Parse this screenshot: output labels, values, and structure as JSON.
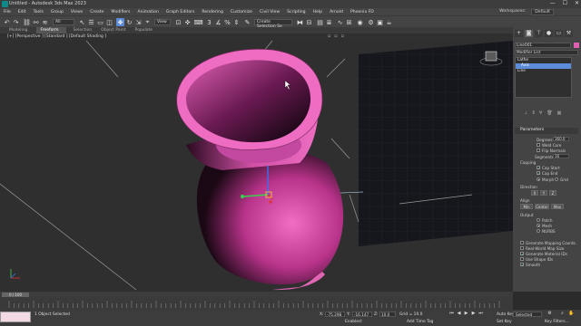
{
  "titlebar": {
    "title": "Untitled - Autodesk 3ds Max 2023",
    "minimize": "—",
    "maximize": "☐",
    "close": "✕"
  },
  "menubar": {
    "items": [
      "File",
      "Edit",
      "Tools",
      "Group",
      "Views",
      "Create",
      "Modifiers",
      "Animation",
      "Graph Editors",
      "Rendering",
      "Customize",
      "Civil View",
      "Scripting",
      "Help",
      "Arnold",
      "Phoenix FD"
    ],
    "workspaces_label": "Workspaces:",
    "workspace_value": "Default"
  },
  "toolbar": {
    "selection_filter": "All",
    "view_dropdown": "View",
    "named_sel": "Create Selection Se"
  },
  "ribbon": {
    "tabs": [
      "Modeling",
      "Freeform",
      "Selection",
      "Object Paint",
      "Populate"
    ],
    "active": "Freeform"
  },
  "viewport": {
    "label": "[+] [Perspective ] [Standard ] [Default Shading ]"
  },
  "command_panel": {
    "object_name": "Line001",
    "modifier_list": "Modifier List",
    "stack": [
      "Lathe",
      "Axis",
      "Line"
    ],
    "stack_selected": "Axis",
    "parameters_title": "Parameters",
    "degrees_label": "Degrees:",
    "degrees_value": "360.0",
    "weld_core": "Weld Core",
    "flip_normals": "Flip Normals",
    "segments_label": "Segments:",
    "segments_value": "16",
    "capping_label": "Capping",
    "cap_start": "Cap Start",
    "cap_end": "Cap End",
    "morph": "Morph",
    "grid": "Grid",
    "direction_label": "Direction",
    "dir_x": "X",
    "dir_y": "Y",
    "dir_z": "Z",
    "align_label": "Align",
    "align_min": "Min",
    "align_center": "Center",
    "align_max": "Max",
    "output_label": "Output",
    "patch": "Patch",
    "mesh": "Mesh",
    "nurbs": "NURBS",
    "gen_mapping": "Generate Mapping Coords.",
    "real_world": "Real-World Map Size",
    "gen_material": "Generate Material IDs",
    "use_shape_ids": "Use Shape IDs",
    "smooth": "Smooth"
  },
  "timeline": {
    "frame_label": "0 / 100"
  },
  "statusbar": {
    "objects_selected": "1 Object Selected",
    "x_label": "X:",
    "x_value": "-75.298",
    "y_label": "Y:",
    "y_value": "-16.147",
    "z_label": "Z:",
    "z_value": "10.0",
    "grid_label": "Grid = 10.0",
    "autokey": "Auto Key",
    "selected": "Selected",
    "set_key": "Set Key",
    "key_filters": "Key Filters...",
    "enabled_label": "Enabled:",
    "add_time_tag": "Add Time Tag"
  },
  "colors": {
    "accent": "#5b8bd9",
    "object": "#e060b0"
  }
}
